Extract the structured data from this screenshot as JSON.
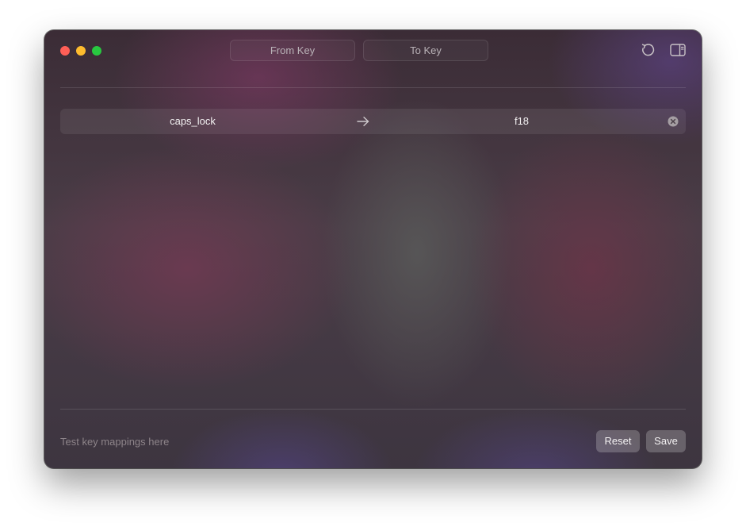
{
  "window": {
    "traffic_lights": [
      "close",
      "minimize",
      "zoom"
    ]
  },
  "header": {
    "tabs": [
      {
        "label": "From Key"
      },
      {
        "label": "To Key"
      }
    ],
    "toolbar": {
      "reload_icon": "arrow-counterclockwise-icon",
      "sidebar_icon": "sidebar-right-icon"
    }
  },
  "mappings": [
    {
      "from": "caps_lock",
      "arrow_icon": "arrow-right-icon",
      "to": "f18",
      "clear_icon": "xmark-circle-icon"
    }
  ],
  "footer": {
    "test_placeholder": "Test key mappings here",
    "test_value": "",
    "reset_label": "Reset",
    "save_label": "Save"
  },
  "colors": {
    "close": "#ff5f57",
    "minimize": "#febc2e",
    "zoom": "#28c840"
  }
}
